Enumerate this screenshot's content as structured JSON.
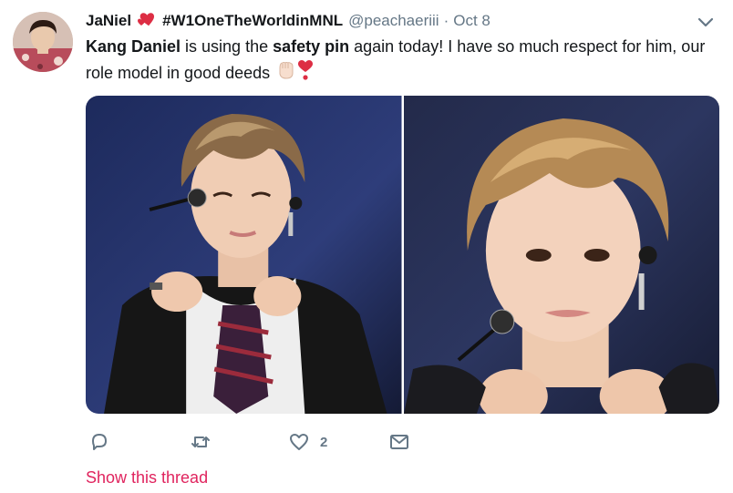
{
  "tweet": {
    "author_name": "JaNiel",
    "author_hashtag": "#W1OneTheWorldinMNL",
    "handle": "@peachaeriii",
    "separator": "·",
    "time": "Oct 8",
    "text": {
      "part1": "Kang Daniel",
      "part2": " is using the ",
      "part3": "safety pin",
      "part4": " again today! I have so much respect for him, our role model in good deeds "
    },
    "icons": {
      "author_emoji": "two-hearts-icon",
      "fist_emoji": "raised-fist-icon",
      "heart_emoji": "heavy-heart-exclamation-icon",
      "more": "chevron-down-icon"
    }
  },
  "actions": {
    "reply_icon": "reply-icon",
    "retweet_icon": "retweet-icon",
    "like_icon": "heart-outline-icon",
    "like_count": "2",
    "dm_icon": "envelope-icon"
  },
  "show_thread": "Show this thread",
  "colors": {
    "text": "#14171a",
    "secondary": "#657786",
    "link": "#e0245e",
    "heart": "#e0245e"
  }
}
